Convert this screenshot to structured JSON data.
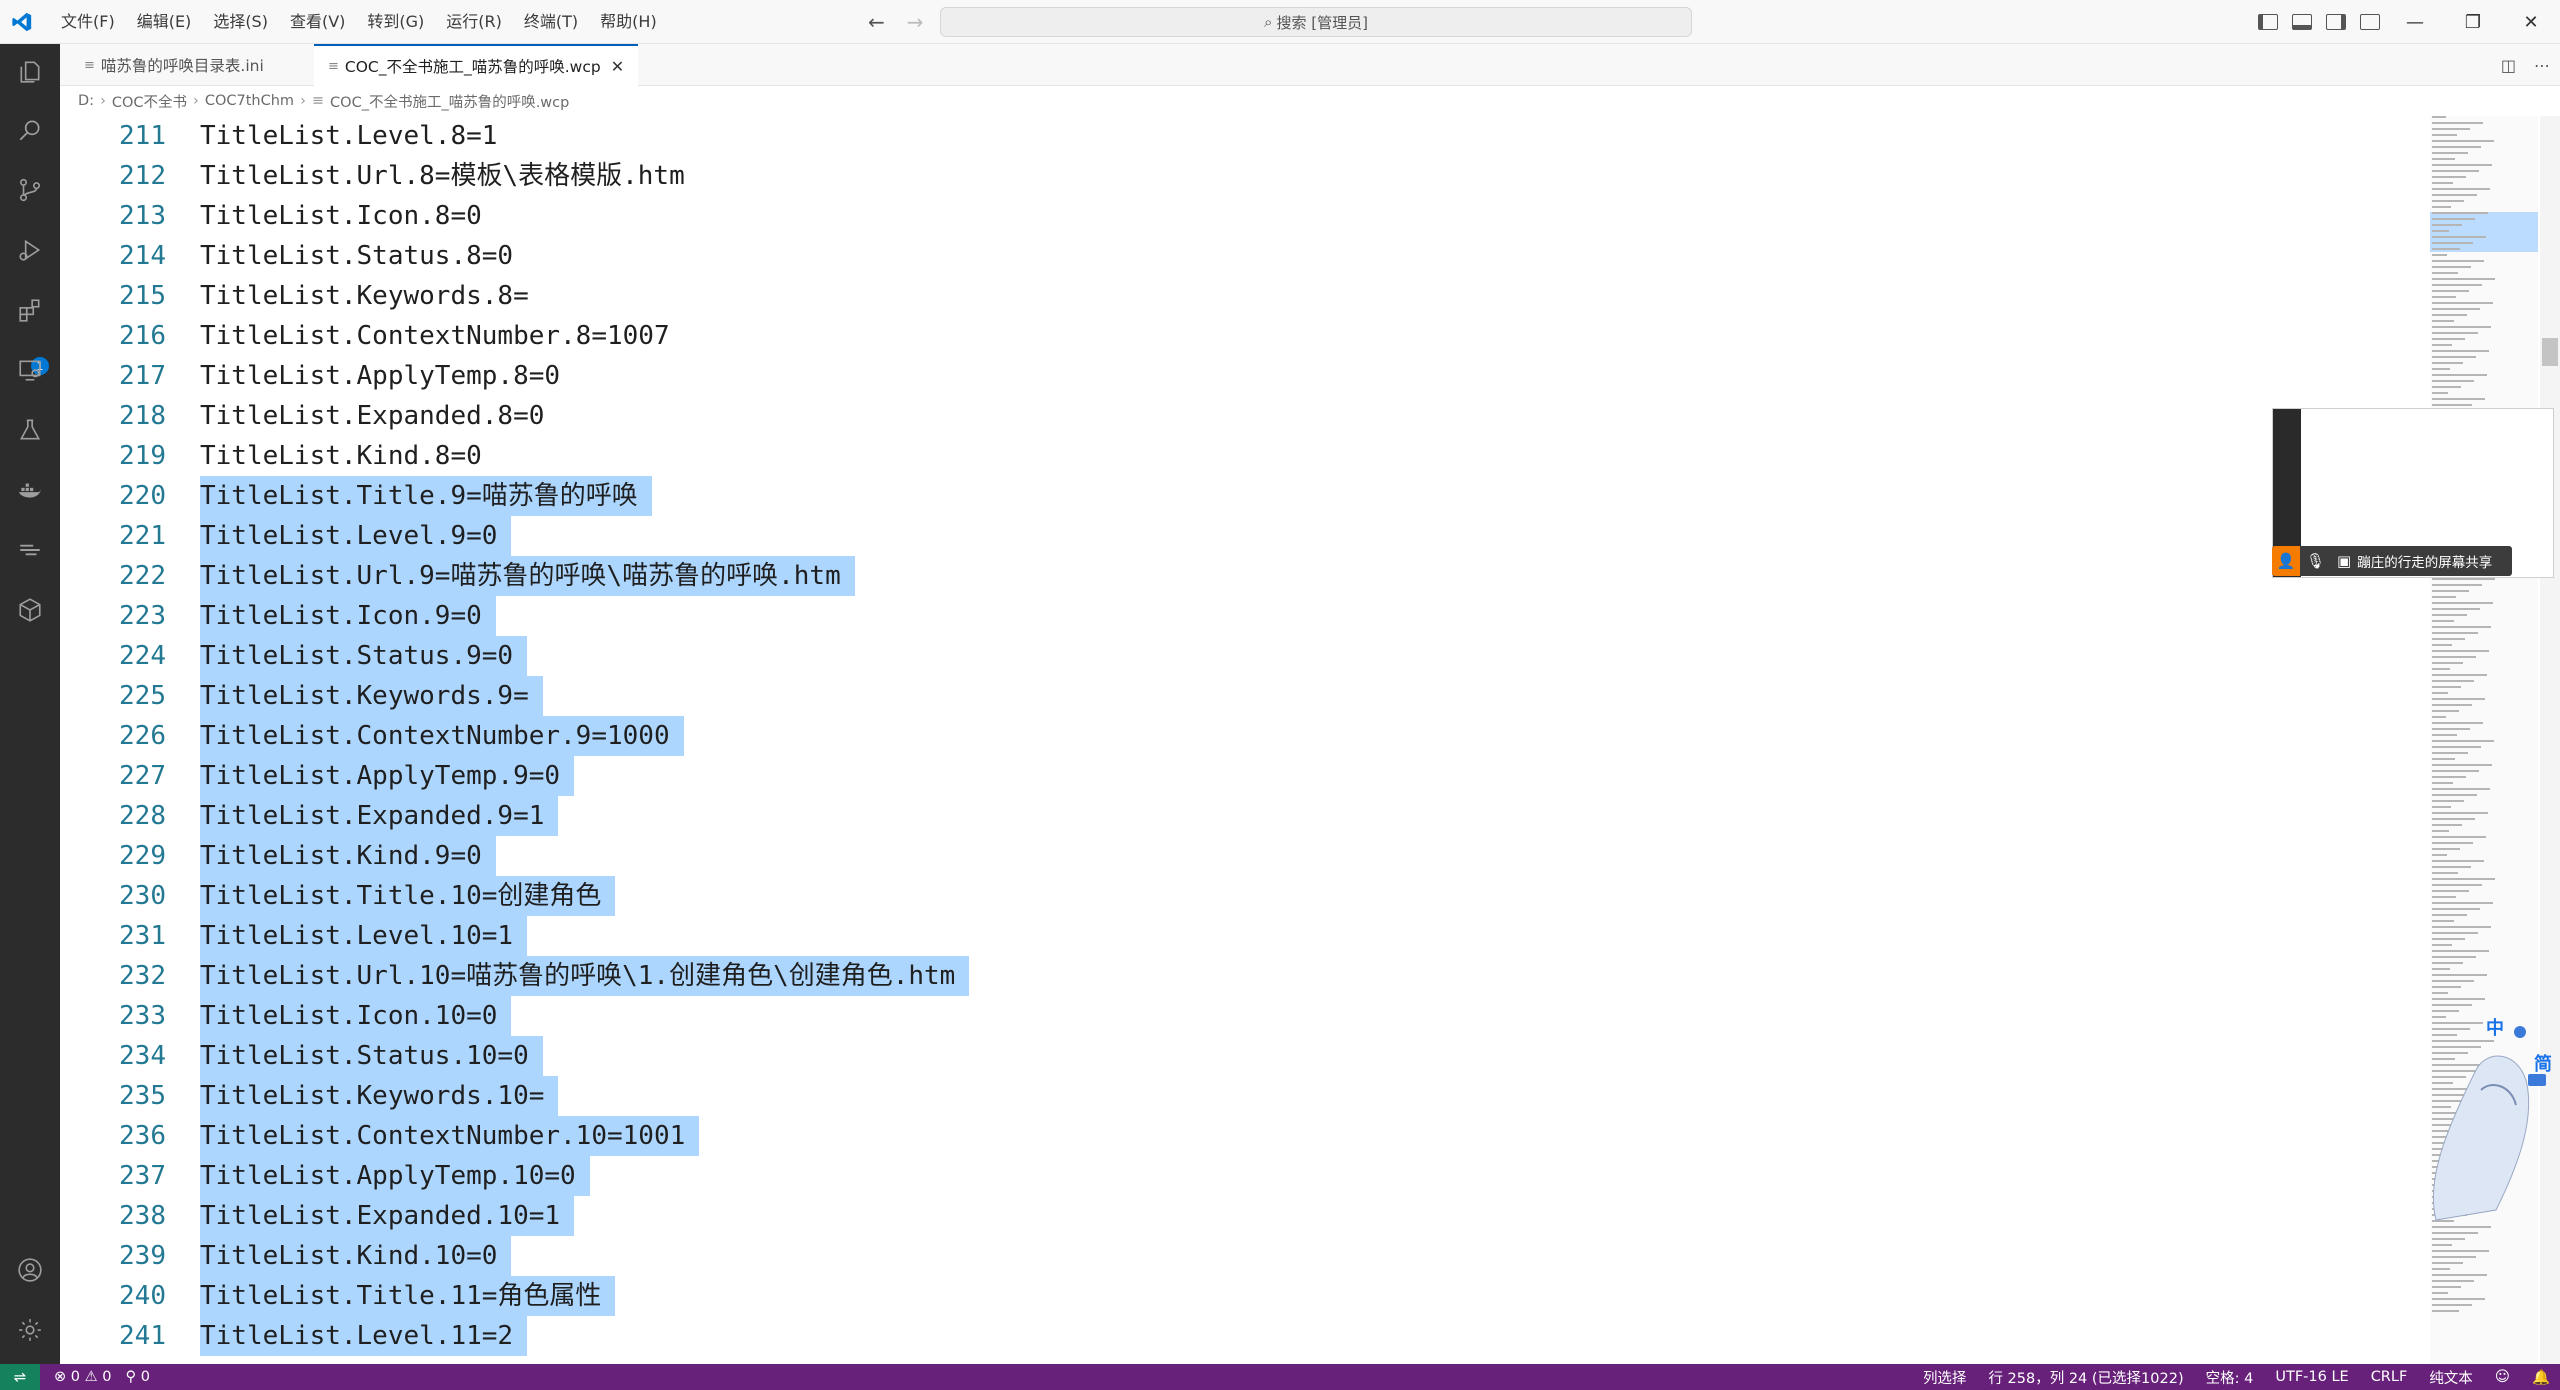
{
  "menu": [
    "文件(F)",
    "编辑(E)",
    "选择(S)",
    "查看(V)",
    "转到(G)",
    "运行(R)",
    "终端(T)",
    "帮助(H)"
  ],
  "search": {
    "label": "搜索 [管理员]"
  },
  "tabs": [
    {
      "label": "喵苏鲁的呼唤目录表.ini",
      "active": false
    },
    {
      "label": "COC_不全书施工_喵苏鲁的呼唤.wcp",
      "active": true
    }
  ],
  "breadcrumb": [
    "D:",
    "COC不全书",
    "COC7thChm",
    "COC_不全书施工_喵苏鲁的呼唤.wcp"
  ],
  "activity_badge": "1",
  "lines": [
    {
      "n": "211",
      "t": "TitleList.Level.8=1",
      "sel": false
    },
    {
      "n": "212",
      "t": "TitleList.Url.8=模板\\表格模版.htm",
      "sel": false
    },
    {
      "n": "213",
      "t": "TitleList.Icon.8=0",
      "sel": false
    },
    {
      "n": "214",
      "t": "TitleList.Status.8=0",
      "sel": false
    },
    {
      "n": "215",
      "t": "TitleList.Keywords.8=",
      "sel": false
    },
    {
      "n": "216",
      "t": "TitleList.ContextNumber.8=1007",
      "sel": false
    },
    {
      "n": "217",
      "t": "TitleList.ApplyTemp.8=0",
      "sel": false
    },
    {
      "n": "218",
      "t": "TitleList.Expanded.8=0",
      "sel": false
    },
    {
      "n": "219",
      "t": "TitleList.Kind.8=0",
      "sel": false
    },
    {
      "n": "220",
      "t": "TitleList.Title.9=喵苏鲁的呼唤",
      "sel": true
    },
    {
      "n": "221",
      "t": "TitleList.Level.9=0",
      "sel": true
    },
    {
      "n": "222",
      "t": "TitleList.Url.9=喵苏鲁的呼唤\\喵苏鲁的呼唤.htm",
      "sel": true
    },
    {
      "n": "223",
      "t": "TitleList.Icon.9=0",
      "sel": true
    },
    {
      "n": "224",
      "t": "TitleList.Status.9=0",
      "sel": true
    },
    {
      "n": "225",
      "t": "TitleList.Keywords.9=",
      "sel": true
    },
    {
      "n": "226",
      "t": "TitleList.ContextNumber.9=1000",
      "sel": true
    },
    {
      "n": "227",
      "t": "TitleList.ApplyTemp.9=0",
      "sel": true
    },
    {
      "n": "228",
      "t": "TitleList.Expanded.9=1",
      "sel": true
    },
    {
      "n": "229",
      "t": "TitleList.Kind.9=0",
      "sel": true
    },
    {
      "n": "230",
      "t": "TitleList.Title.10=创建角色",
      "sel": true
    },
    {
      "n": "231",
      "t": "TitleList.Level.10=1",
      "sel": true
    },
    {
      "n": "232",
      "t": "TitleList.Url.10=喵苏鲁的呼唤\\1.创建角色\\创建角色.htm",
      "sel": true
    },
    {
      "n": "233",
      "t": "TitleList.Icon.10=0",
      "sel": true
    },
    {
      "n": "234",
      "t": "TitleList.Status.10=0",
      "sel": true
    },
    {
      "n": "235",
      "t": "TitleList.Keywords.10=",
      "sel": true
    },
    {
      "n": "236",
      "t": "TitleList.ContextNumber.10=1001",
      "sel": true
    },
    {
      "n": "237",
      "t": "TitleList.ApplyTemp.10=0",
      "sel": true
    },
    {
      "n": "238",
      "t": "TitleList.Expanded.10=1",
      "sel": true
    },
    {
      "n": "239",
      "t": "TitleList.Kind.10=0",
      "sel": true
    },
    {
      "n": "240",
      "t": "TitleList.Title.11=角色属性",
      "sel": true
    },
    {
      "n": "241",
      "t": "TitleList.Level.11=2",
      "sel": true
    }
  ],
  "share": {
    "label": "蹦庄的行走的屏幕共享"
  },
  "ime": {
    "zh": "中",
    "jian": "简"
  },
  "status": {
    "errors": "0",
    "warnings": "0",
    "ports": "0",
    "selection_mode": "列选择",
    "position": "行 258，列 24 (已选择1022)",
    "spaces": "空格: 4",
    "encoding": "UTF-16 LE",
    "eol": "CRLF",
    "language": "纯文本"
  },
  "colors": {
    "statusbar": "#68217a",
    "remote": "#16825d",
    "selection": "#add6ff",
    "line_number": "#237893"
  }
}
